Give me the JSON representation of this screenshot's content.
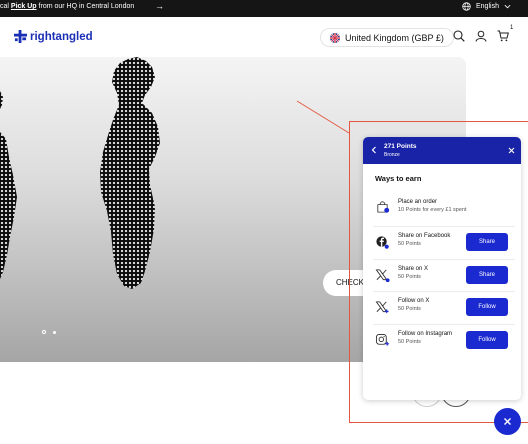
{
  "announcement": {
    "text_before": "cal ",
    "text_bold": "Pick Up",
    "text_after": " from our HQ in Central London",
    "next_arrow": "→",
    "language": "English"
  },
  "header": {
    "logo_text": "rightangled",
    "country_selector": "United Kingdom (GBP £)",
    "cart_count": "1"
  },
  "hero": {
    "cta_label": "CHECK S",
    "slide_count": 2,
    "active_slide": 1
  },
  "rewards": {
    "points": "271 Points",
    "tier": "Bronze",
    "section_title": "Ways to earn",
    "ways": [
      {
        "icon": "shopping-bag-icon",
        "name": "Place an order",
        "detail": "10 Points for every £1 spent",
        "button": ""
      },
      {
        "icon": "facebook-share-icon",
        "name": "Share on Facebook",
        "detail": "50 Points",
        "button": "Share"
      },
      {
        "icon": "x-share-icon",
        "name": "Share on X",
        "detail": "50 Points",
        "button": "Share"
      },
      {
        "icon": "x-follow-icon",
        "name": "Follow on X",
        "detail": "50 Points",
        "button": "Follow"
      },
      {
        "icon": "instagram-follow-icon",
        "name": "Follow on Instagram",
        "detail": "50 Points",
        "button": "Follow"
      }
    ]
  },
  "colors": {
    "brand_blue": "#1b2ad0",
    "panel_header": "#1923a8",
    "annotation_red": "#e4573f",
    "topbar": "#151515"
  }
}
